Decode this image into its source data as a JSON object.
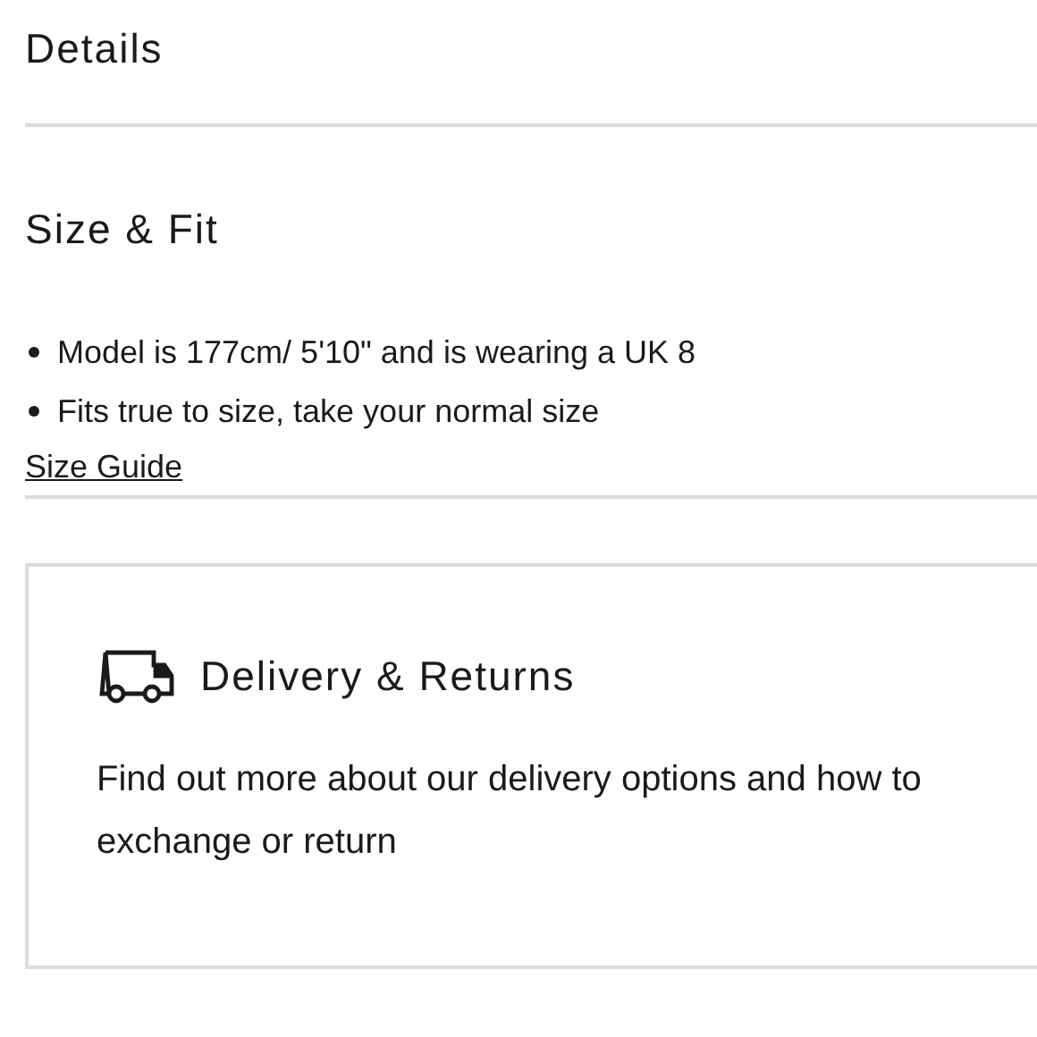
{
  "sections": [
    {
      "title": "Details"
    },
    {
      "title": "Size & Fit"
    }
  ],
  "fit_notes": [
    "Model is 177cm/ 5'10\" and is wearing a UK 8",
    "Fits true to size, take your normal size"
  ],
  "size_guide_link": "Size Guide",
  "delivery": {
    "title": "Delivery & Returns",
    "text": "Find out more about our delivery options and how to exchange or return"
  }
}
